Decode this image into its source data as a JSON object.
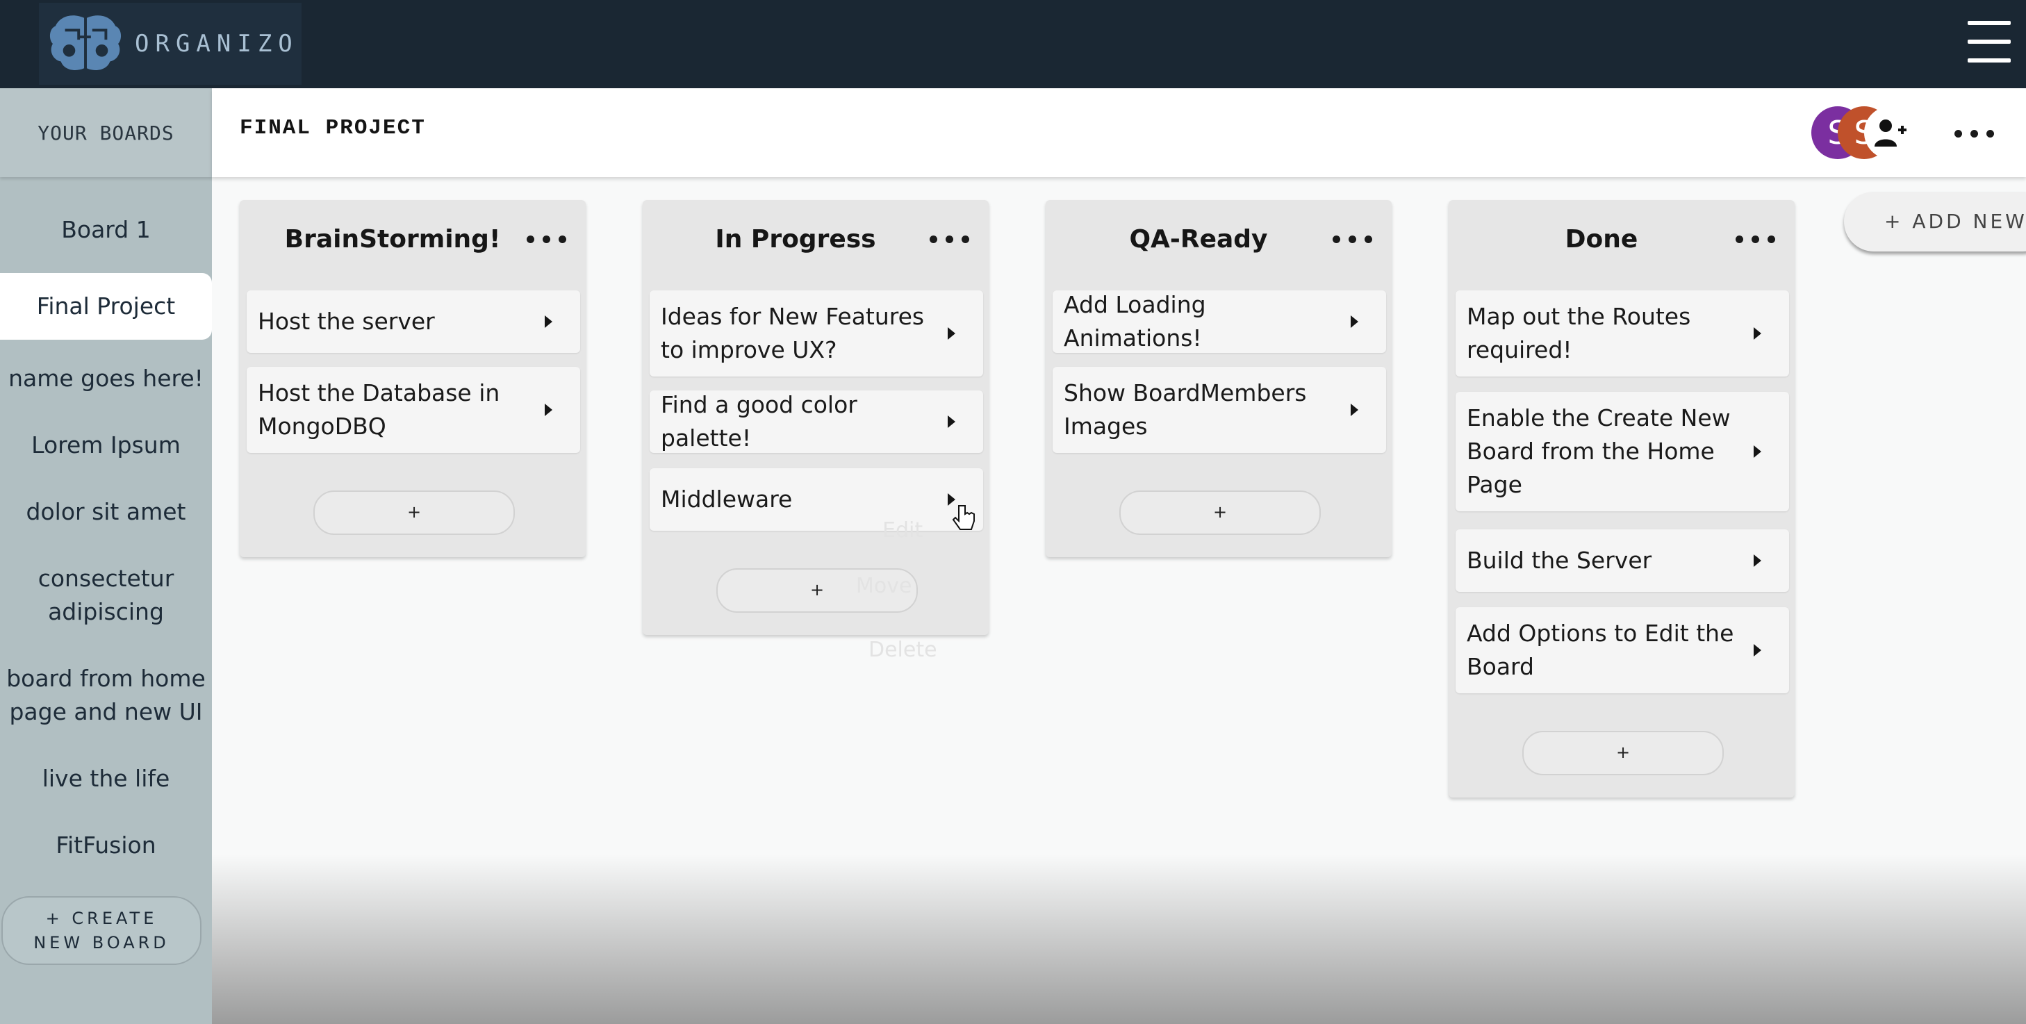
{
  "app": {
    "name": "ORGANIZO"
  },
  "sidebar": {
    "heading": "YOUR BOARDS",
    "items": [
      {
        "label": "Board 1"
      },
      {
        "label": "Final Project"
      },
      {
        "label": "name goes here!"
      },
      {
        "label": "Lorem Ipsum"
      },
      {
        "label": "dolor sit amet"
      },
      {
        "label": "consectetur adipiscing"
      },
      {
        "label": "board from home page and new UI"
      },
      {
        "label": "live the life"
      },
      {
        "label": "FitFusion"
      }
    ],
    "create_label": "+ CREATE NEW BOARD"
  },
  "header": {
    "title": "FINAL PROJECT",
    "avatars": [
      {
        "initial": "S",
        "color": "#7b2fa0"
      },
      {
        "initial": "S",
        "color": "#c0512b"
      }
    ],
    "invite_icon": "user-plus-icon",
    "more_icon": "ellipsis-icon"
  },
  "columns": [
    {
      "title": "BrainStorming!",
      "add_label": "+",
      "cards": [
        {
          "text": "Host the server"
        },
        {
          "text": "Host the Database in MongoDBQ"
        }
      ]
    },
    {
      "title": "In Progress",
      "add_label": "+",
      "cards": [
        {
          "text": "Ideas for New Features to improve UX?"
        },
        {
          "text": "Find a good color palette!"
        },
        {
          "text": "Middleware"
        }
      ]
    },
    {
      "title": "QA-Ready",
      "add_label": "+",
      "cards": [
        {
          "text": "Add Loading Animations!"
        },
        {
          "text": "Show BoardMembers Images"
        }
      ]
    },
    {
      "title": "Done",
      "add_label": "+",
      "cards": [
        {
          "text": "Map out the Routes required!"
        },
        {
          "text": "Enable the Create New Board from the Home Page"
        },
        {
          "text": "Build the Server"
        },
        {
          "text": "Add Options to Edit the Board"
        }
      ]
    }
  ],
  "card_menu": {
    "items": [
      "Edit",
      "Move",
      "Delete"
    ]
  },
  "add_list_label": "+ ADD NEW",
  "colors": {
    "topbar": "#1a2733",
    "sidebar": "#b1bfc2",
    "column": "#e6e6e6"
  }
}
